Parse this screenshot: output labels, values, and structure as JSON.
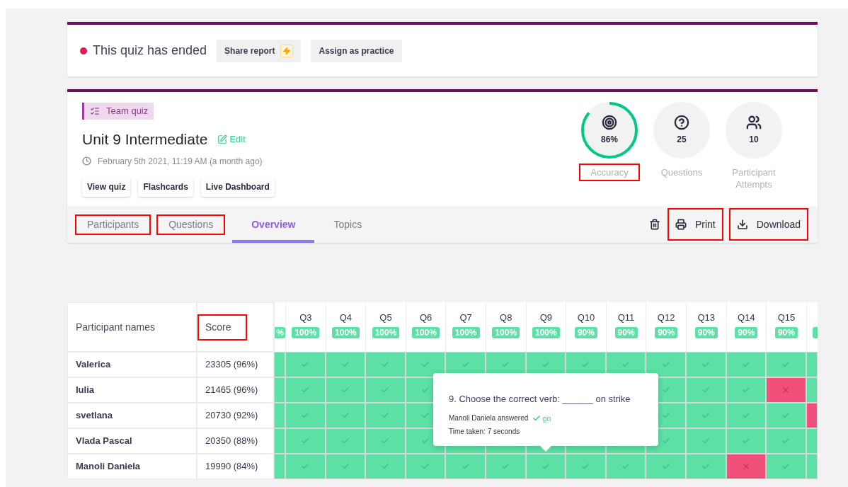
{
  "status": {
    "text": "This quiz has ended",
    "buttons": [
      {
        "label": "Share report",
        "kind": "share"
      },
      {
        "label": "Assign as practice",
        "kind": "plain"
      }
    ]
  },
  "quiz": {
    "tag": "Team quiz",
    "title": "Unit 9 Intermediate",
    "edit": "Edit",
    "date": "February 5th 2021, 11:19 AM (a month ago)",
    "buttons": [
      "View quiz",
      "Flashcards",
      "Live Dashboard"
    ]
  },
  "stats": [
    {
      "kind": "accuracy",
      "value": "86%",
      "label": "Accuracy",
      "highlighted": true
    },
    {
      "kind": "questions",
      "value": "25",
      "label": "Questions",
      "highlighted": false
    },
    {
      "kind": "attempts",
      "value": "10",
      "label": "Participant Attempts",
      "highlighted": false
    }
  ],
  "tabs": [
    {
      "label": "Participants",
      "selected": false,
      "highlighted": true
    },
    {
      "label": "Questions",
      "selected": false,
      "highlighted": true
    },
    {
      "label": "Overview",
      "selected": true,
      "highlighted": false
    },
    {
      "label": "Topics",
      "selected": false,
      "highlighted": false
    }
  ],
  "actions": [
    {
      "kind": "delete",
      "highlighted": false
    },
    {
      "kind": "print",
      "label": "Print",
      "highlighted": true
    },
    {
      "kind": "download",
      "label": "Download",
      "highlighted": true
    }
  ],
  "table": {
    "name_header": "Participant names",
    "score_header": {
      "label": "Score",
      "highlighted": true
    },
    "columns": [
      {
        "kind": "cut",
        "badge": "%"
      },
      {
        "kind": "full",
        "label": "Q3",
        "badge": "100%"
      },
      {
        "kind": "full",
        "label": "Q4",
        "badge": "100%"
      },
      {
        "kind": "full",
        "label": "Q5",
        "badge": "100%"
      },
      {
        "kind": "full",
        "label": "Q6",
        "badge": "100%"
      },
      {
        "kind": "full",
        "label": "Q7",
        "badge": "100%"
      },
      {
        "kind": "full",
        "label": "Q8",
        "badge": "100%"
      },
      {
        "kind": "full",
        "label": "Q9",
        "badge": "100%"
      },
      {
        "kind": "full",
        "label": "Q10",
        "badge": "90%"
      },
      {
        "kind": "full",
        "label": "Q11",
        "badge": "90%"
      },
      {
        "kind": "full",
        "label": "Q12",
        "badge": "90%"
      },
      {
        "kind": "full",
        "label": "Q13",
        "badge": "90%"
      },
      {
        "kind": "full",
        "label": "Q14",
        "badge": "90%"
      },
      {
        "kind": "full",
        "label": "Q15",
        "badge": "90%"
      },
      {
        "kind": "cut"
      }
    ],
    "rows": [
      {
        "name": "Valerica",
        "score": "23305 (96%)",
        "results": [
          {
            "kind": "answer",
            "correct": true
          },
          {
            "kind": "answer",
            "correct": true
          },
          {
            "kind": "answer",
            "correct": true
          },
          {
            "kind": "answer",
            "correct": true
          },
          {
            "kind": "answer",
            "correct": true
          },
          {
            "kind": "answer",
            "correct": true
          },
          {
            "kind": "answer",
            "correct": true
          },
          {
            "kind": "answer",
            "correct": true
          },
          {
            "kind": "answer",
            "correct": true
          },
          {
            "kind": "answer",
            "correct": true
          },
          {
            "kind": "answer",
            "correct": true
          },
          {
            "kind": "answer",
            "correct": true
          },
          {
            "kind": "answer",
            "correct": true
          },
          {
            "kind": "answer",
            "correct": true
          },
          {
            "kind": "answer",
            "correct": true
          }
        ]
      },
      {
        "name": "Iulia",
        "score": "21465 (96%)",
        "results": [
          {
            "kind": "answer",
            "correct": true
          },
          {
            "kind": "answer",
            "correct": true
          },
          {
            "kind": "answer",
            "correct": true
          },
          {
            "kind": "answer",
            "correct": true
          },
          {
            "kind": "answer",
            "correct": true
          },
          {
            "kind": "covered"
          },
          {
            "kind": "covered"
          },
          {
            "kind": "covered"
          },
          {
            "kind": "covered"
          },
          {
            "kind": "covered"
          },
          {
            "kind": "answer",
            "correct": true
          },
          {
            "kind": "answer",
            "correct": true
          },
          {
            "kind": "answer",
            "correct": true
          },
          {
            "kind": "answer",
            "correct": false
          },
          {
            "kind": "answer",
            "correct": true
          }
        ]
      },
      {
        "name": "svetlana",
        "score": "20730 (92%)",
        "results": [
          {
            "kind": "answer",
            "correct": true
          },
          {
            "kind": "answer",
            "correct": true
          },
          {
            "kind": "answer",
            "correct": true
          },
          {
            "kind": "answer",
            "correct": true
          },
          {
            "kind": "answer",
            "correct": true
          },
          {
            "kind": "covered"
          },
          {
            "kind": "covered"
          },
          {
            "kind": "covered"
          },
          {
            "kind": "covered"
          },
          {
            "kind": "covered"
          },
          {
            "kind": "answer",
            "correct": true
          },
          {
            "kind": "answer",
            "correct": true
          },
          {
            "kind": "answer",
            "correct": true
          },
          {
            "kind": "answer",
            "correct": true
          },
          {
            "kind": "answer",
            "correct": false
          }
        ]
      },
      {
        "name": "Vlada Pascal",
        "score": "20350 (88%)",
        "results": [
          {
            "kind": "answer",
            "correct": true
          },
          {
            "kind": "answer",
            "correct": true
          },
          {
            "kind": "answer",
            "correct": true
          },
          {
            "kind": "answer",
            "correct": true
          },
          {
            "kind": "answer",
            "correct": true
          },
          {
            "kind": "answer",
            "correct": true
          },
          {
            "kind": "answer",
            "correct": true
          },
          {
            "kind": "answer",
            "correct": true
          },
          {
            "kind": "answer",
            "correct": true
          },
          {
            "kind": "answer",
            "correct": true
          },
          {
            "kind": "answer",
            "correct": true
          },
          {
            "kind": "answer",
            "correct": true
          },
          {
            "kind": "answer",
            "correct": true
          },
          {
            "kind": "answer",
            "correct": true
          },
          {
            "kind": "answer",
            "correct": true
          }
        ]
      },
      {
        "name": "Manoli Daniela",
        "score": "19990 (84%)",
        "results": [
          {
            "kind": "answer",
            "correct": true
          },
          {
            "kind": "answer",
            "correct": true
          },
          {
            "kind": "answer",
            "correct": true
          },
          {
            "kind": "answer",
            "correct": true
          },
          {
            "kind": "answer",
            "correct": true
          },
          {
            "kind": "answer",
            "correct": true
          },
          {
            "kind": "answer",
            "correct": true
          },
          {
            "kind": "answer",
            "correct": true
          },
          {
            "kind": "answer",
            "correct": true
          },
          {
            "kind": "answer",
            "correct": true
          },
          {
            "kind": "answer",
            "correct": true
          },
          {
            "kind": "answer",
            "correct": true
          },
          {
            "kind": "answer",
            "correct": false
          },
          {
            "kind": "answer",
            "correct": true
          },
          {
            "kind": "answer",
            "correct": true
          }
        ]
      }
    ]
  },
  "tooltip": {
    "question": "9. Choose the correct verb: ______ on strike",
    "answer_prefix": "Manoli Daniela answered",
    "answer": "go",
    "answer_correct": true,
    "time": "Time taken: 7 seconds"
  }
}
